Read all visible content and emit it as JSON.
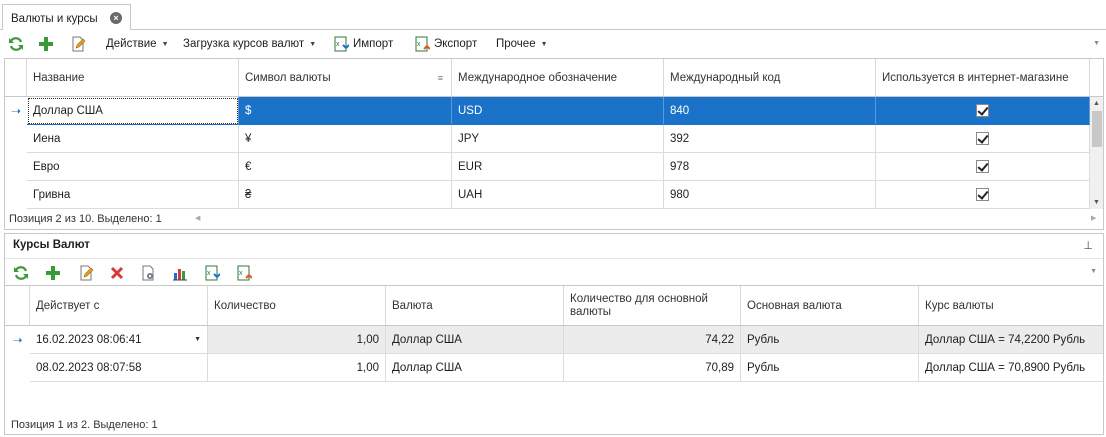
{
  "tab": {
    "title": "Валюты и курсы",
    "close": "×"
  },
  "toolbar": {
    "action_label": "Действие",
    "load_rates_label": "Загрузка курсов валют",
    "import_label": "Импорт",
    "export_label": "Экспорт",
    "other_label": "Прочее"
  },
  "currencies": {
    "headers": [
      "Название",
      "Символ валюты",
      "Международное обозначение",
      "Международный код",
      "Используется в интернет-магазине"
    ],
    "rows": [
      {
        "name": "Доллар США",
        "symbol": "$",
        "iso": "USD",
        "code": "840",
        "used": true,
        "selected": true
      },
      {
        "name": "Иена",
        "symbol": "¥",
        "iso": "JPY",
        "code": "392",
        "used": true,
        "selected": false
      },
      {
        "name": "Евро",
        "symbol": "€",
        "iso": "EUR",
        "code": "978",
        "used": true,
        "selected": false
      },
      {
        "name": "Гривна",
        "symbol": "₴",
        "iso": "UAH",
        "code": "980",
        "used": true,
        "selected": false
      }
    ],
    "status": "Позиция 2 из 10. Выделено: 1"
  },
  "rates_panel": {
    "title": "Курсы Валют",
    "headers": [
      "Действует с",
      "Количество",
      "Валюта",
      "Количество для основной валюты",
      "Основная валюта",
      "Курс валюты"
    ],
    "rows": [
      {
        "date": "16.02.2023 08:06:41",
        "qty": "1,00",
        "currency": "Доллар США",
        "base_qty": "74,22",
        "base_currency": "Рубль",
        "rate": "Доллар США = 74,2200 Рубль"
      },
      {
        "date": "08.02.2023 08:07:58",
        "qty": "1,00",
        "currency": "Доллар США",
        "base_qty": "70,89",
        "base_currency": "Рубль",
        "rate": "Доллар США = 70,8900 Рубль"
      }
    ],
    "status": "Позиция 1 из 2. Выделено: 1"
  },
  "colors": {
    "accent": "#1a73c8",
    "green": "#3a9a3a",
    "red": "#d43b3b"
  }
}
